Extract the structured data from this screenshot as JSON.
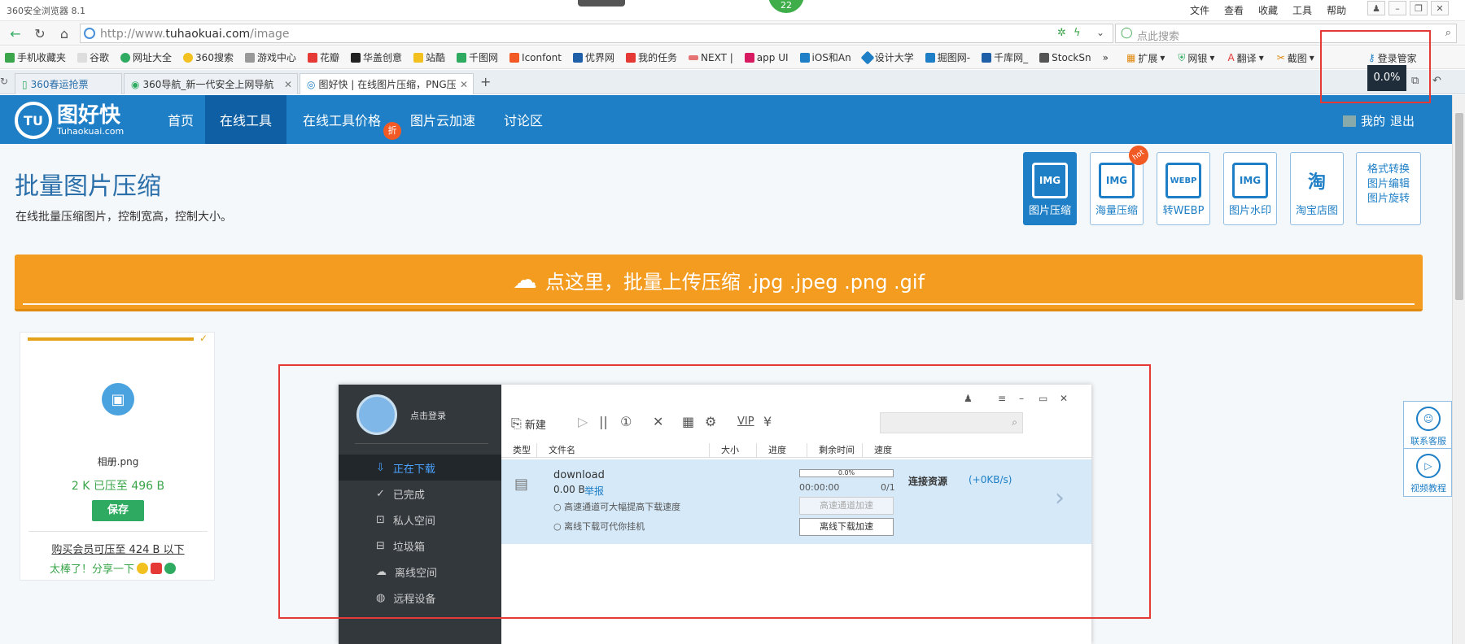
{
  "browser": {
    "title": "360安全浏览器 8.1",
    "menus": [
      "文件",
      "查看",
      "收藏",
      "工具",
      "帮助"
    ],
    "badge": "22",
    "url_prefix": "http://www.",
    "url_domain": "tuhaokuai.com",
    "url_path": "/image",
    "search_placeholder": "点此搜索",
    "bookmarks": [
      "手机收藏夹",
      "谷歌",
      "网址大全",
      "360搜索",
      "游戏中心",
      "花瓣",
      "华盖创意",
      "站酷",
      "千图网",
      "Iconfont",
      "优界网",
      "我的任务",
      "NEXT |",
      "app UI",
      "iOS和An",
      "设计大学",
      "掘图网-",
      "千库网_",
      "StockSn",
      "»"
    ],
    "right_tools": [
      "扩展",
      "网银",
      "翻译",
      "截图",
      "登录管家"
    ],
    "tabs": [
      "360春运抢票",
      "360导航_新一代安全上网导航",
      "图好快 | 在线图片压缩，PNG压"
    ],
    "tooltip": "0.0%"
  },
  "site": {
    "logo_name": "图好快",
    "logo_domain": "Tuhaokuai.com",
    "logo_mark": "TU",
    "nav": [
      "首页",
      "在线工具",
      "在线工具价格",
      "图片云加速",
      "讨论区"
    ],
    "nav_badge": "折",
    "user_my": "我的",
    "user_logout": "退出",
    "title": "批量图片压缩",
    "subtitle": "在线批量压缩图片，控制宽高，控制大小。",
    "tools": [
      "图片压缩",
      "海量压缩",
      "转WEBP",
      "图片水印",
      "淘宝店图"
    ],
    "tool_marks": [
      "IMG",
      "IMG",
      "WEBP",
      "IMG",
      "淘"
    ],
    "hot": "hot",
    "more_links": [
      "格式转换",
      "图片编辑",
      "图片旋转"
    ],
    "upload_text": "点这里，批量上传压缩 .jpg .jpeg .png .gif",
    "file": {
      "name": "相册.png",
      "size_text": "2 K 已压至 496 B",
      "save": "保存",
      "vip_text": "购买会员可压至 424 B 以下",
      "share_text": "太棒了！分享一下",
      "progress": 1.0
    },
    "right_float": [
      "联系客服",
      "视频教程"
    ]
  },
  "downloader": {
    "login": "点击登录",
    "nav": [
      "正在下载",
      "已完成",
      "私人空间",
      "垃圾箱",
      "离线空间",
      "远程设备"
    ],
    "new_label": "新建",
    "vip_label": "VIP",
    "columns": [
      "类型",
      "文件名",
      "大小",
      "进度",
      "剩余时间",
      "速度"
    ],
    "item": {
      "name": "download",
      "size": "0.00 B",
      "report": "举报",
      "tip1": "高速通道可大幅提高下载速度",
      "tip2": "离线下载可代你挂机",
      "progress_text": "0.0%",
      "progress": 0.0,
      "time": "00:00:00",
      "count": "0/1",
      "btn_fast": "高速通道加速",
      "btn_offline": "离线下载加速",
      "status": "连接资源",
      "speed": "(+0KB/s)"
    }
  },
  "colors": {
    "brand": "#1e7fc6",
    "upload": "#f39c1f",
    "save": "#2eab60",
    "highlight": "#e53935"
  }
}
